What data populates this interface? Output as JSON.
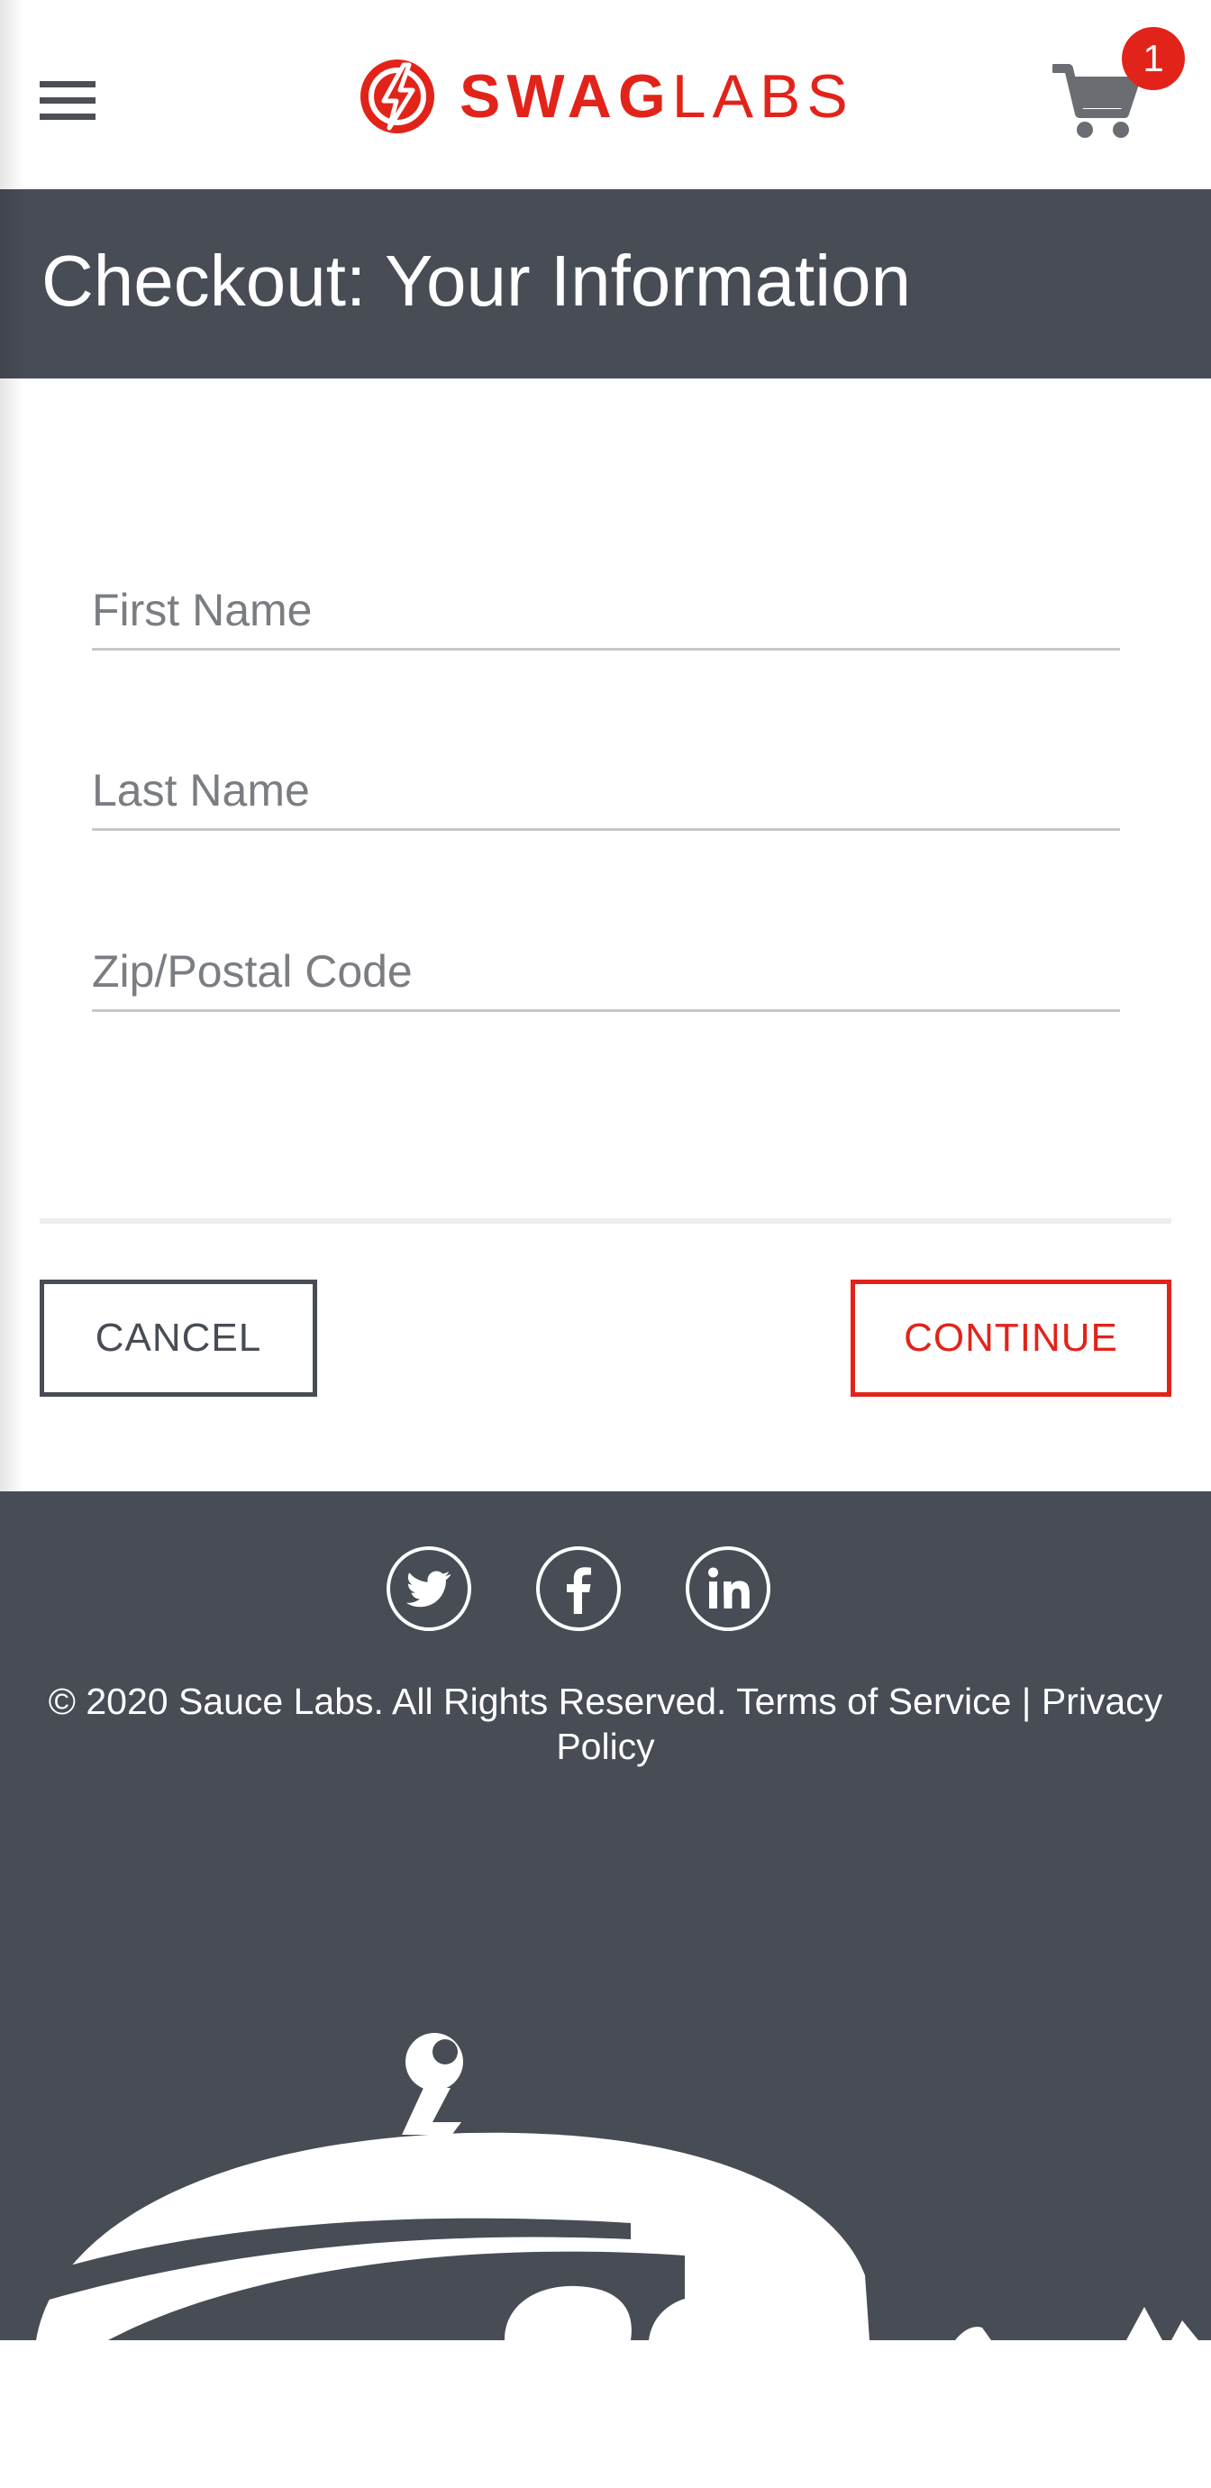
{
  "header": {
    "menu_icon": "hamburger-menu-icon",
    "logo": {
      "icon": "swag-labs-bolt-icon",
      "text_bold": "SWAG",
      "text_light": "LABS"
    },
    "cart": {
      "icon": "shopping-cart-icon",
      "badge_count": "1"
    }
  },
  "title_bar": {
    "title": "Checkout: Your Information"
  },
  "form": {
    "first_name": {
      "value": "",
      "placeholder": "First Name"
    },
    "last_name": {
      "value": "",
      "placeholder": "Last Name"
    },
    "postal_code": {
      "value": "",
      "placeholder": "Zip/Postal Code"
    }
  },
  "actions": {
    "cancel_label": "CANCEL",
    "continue_label": "CONTINUE"
  },
  "footer": {
    "social": [
      "twitter-icon",
      "facebook-icon",
      "linkedin-icon"
    ],
    "copyright": "© 2020 Sauce Labs. All Rights Reserved. Terms of Service | Privacy Policy",
    "mascot": "swag-bot-mascot"
  },
  "colors": {
    "accent": "#e2231a",
    "header_bg": "#474c55",
    "text_muted": "#7a7d82",
    "white": "#ffffff"
  }
}
